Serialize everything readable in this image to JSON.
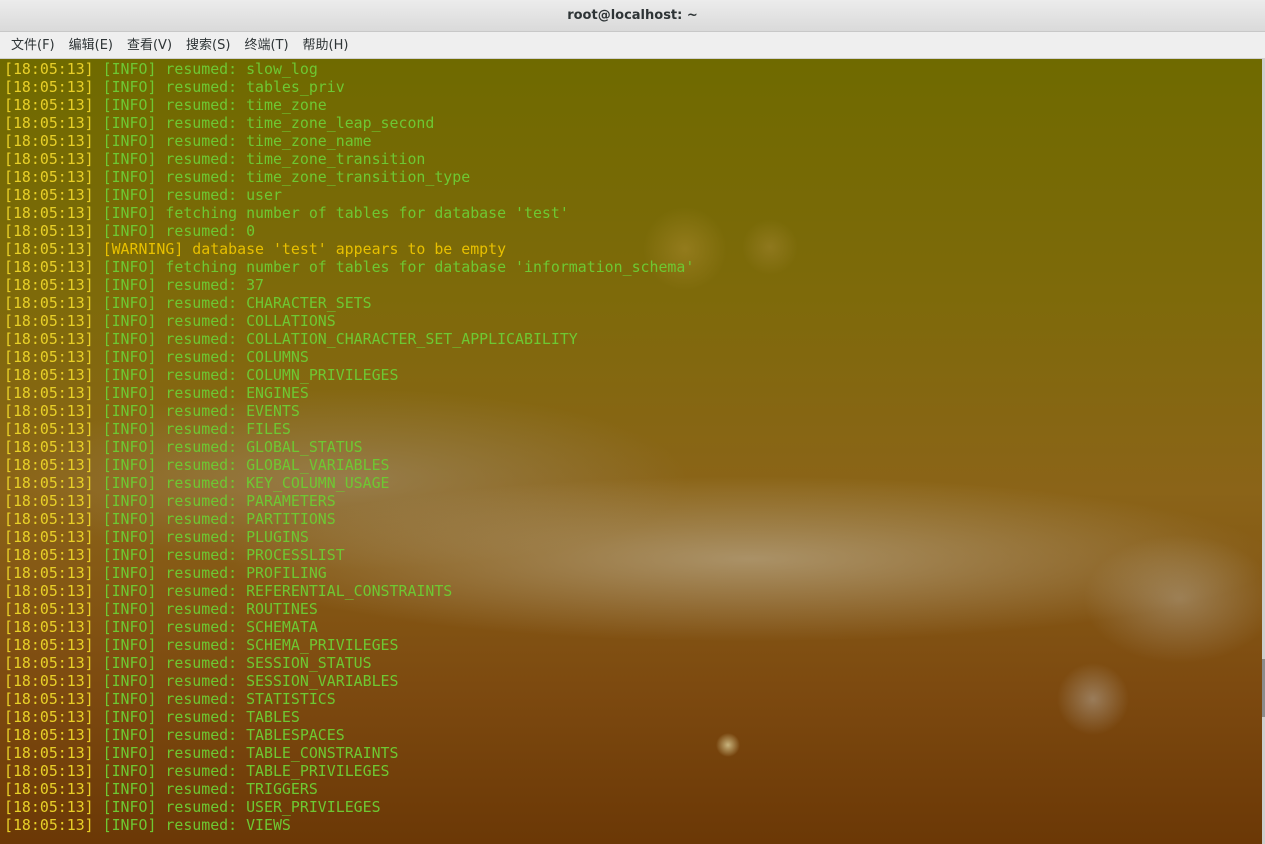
{
  "window": {
    "title": "root@localhost: ~"
  },
  "menu": [
    {
      "name": "menu-file",
      "label": "文件(F)"
    },
    {
      "name": "menu-edit",
      "label": "编辑(E)"
    },
    {
      "name": "menu-view",
      "label": "查看(V)"
    },
    {
      "name": "menu-search",
      "label": "搜索(S)"
    },
    {
      "name": "menu-terminal",
      "label": "终端(T)"
    },
    {
      "name": "menu-help",
      "label": "帮助(H)"
    }
  ],
  "colors": {
    "timestamp": "#e8d028",
    "info": "#6ec832",
    "warning": "#e8c000"
  },
  "log_lines": [
    {
      "time": "[18:05:13]",
      "level": "[INFO]",
      "message": "resumed: slow_log"
    },
    {
      "time": "[18:05:13]",
      "level": "[INFO]",
      "message": "resumed: tables_priv"
    },
    {
      "time": "[18:05:13]",
      "level": "[INFO]",
      "message": "resumed: time_zone"
    },
    {
      "time": "[18:05:13]",
      "level": "[INFO]",
      "message": "resumed: time_zone_leap_second"
    },
    {
      "time": "[18:05:13]",
      "level": "[INFO]",
      "message": "resumed: time_zone_name"
    },
    {
      "time": "[18:05:13]",
      "level": "[INFO]",
      "message": "resumed: time_zone_transition"
    },
    {
      "time": "[18:05:13]",
      "level": "[INFO]",
      "message": "resumed: time_zone_transition_type"
    },
    {
      "time": "[18:05:13]",
      "level": "[INFO]",
      "message": "resumed: user"
    },
    {
      "time": "[18:05:13]",
      "level": "[INFO]",
      "message": "fetching number of tables for database 'test'"
    },
    {
      "time": "[18:05:13]",
      "level": "[INFO]",
      "message": "resumed: 0"
    },
    {
      "time": "[18:05:13]",
      "level": "[WARNING]",
      "message": "database 'test' appears to be empty"
    },
    {
      "time": "[18:05:13]",
      "level": "[INFO]",
      "message": "fetching number of tables for database 'information_schema'"
    },
    {
      "time": "[18:05:13]",
      "level": "[INFO]",
      "message": "resumed: 37"
    },
    {
      "time": "[18:05:13]",
      "level": "[INFO]",
      "message": "resumed: CHARACTER_SETS"
    },
    {
      "time": "[18:05:13]",
      "level": "[INFO]",
      "message": "resumed: COLLATIONS"
    },
    {
      "time": "[18:05:13]",
      "level": "[INFO]",
      "message": "resumed: COLLATION_CHARACTER_SET_APPLICABILITY"
    },
    {
      "time": "[18:05:13]",
      "level": "[INFO]",
      "message": "resumed: COLUMNS"
    },
    {
      "time": "[18:05:13]",
      "level": "[INFO]",
      "message": "resumed: COLUMN_PRIVILEGES"
    },
    {
      "time": "[18:05:13]",
      "level": "[INFO]",
      "message": "resumed: ENGINES"
    },
    {
      "time": "[18:05:13]",
      "level": "[INFO]",
      "message": "resumed: EVENTS"
    },
    {
      "time": "[18:05:13]",
      "level": "[INFO]",
      "message": "resumed: FILES"
    },
    {
      "time": "[18:05:13]",
      "level": "[INFO]",
      "message": "resumed: GLOBAL_STATUS"
    },
    {
      "time": "[18:05:13]",
      "level": "[INFO]",
      "message": "resumed: GLOBAL_VARIABLES"
    },
    {
      "time": "[18:05:13]",
      "level": "[INFO]",
      "message": "resumed: KEY_COLUMN_USAGE"
    },
    {
      "time": "[18:05:13]",
      "level": "[INFO]",
      "message": "resumed: PARAMETERS"
    },
    {
      "time": "[18:05:13]",
      "level": "[INFO]",
      "message": "resumed: PARTITIONS"
    },
    {
      "time": "[18:05:13]",
      "level": "[INFO]",
      "message": "resumed: PLUGINS"
    },
    {
      "time": "[18:05:13]",
      "level": "[INFO]",
      "message": "resumed: PROCESSLIST"
    },
    {
      "time": "[18:05:13]",
      "level": "[INFO]",
      "message": "resumed: PROFILING"
    },
    {
      "time": "[18:05:13]",
      "level": "[INFO]",
      "message": "resumed: REFERENTIAL_CONSTRAINTS"
    },
    {
      "time": "[18:05:13]",
      "level": "[INFO]",
      "message": "resumed: ROUTINES"
    },
    {
      "time": "[18:05:13]",
      "level": "[INFO]",
      "message": "resumed: SCHEMATA"
    },
    {
      "time": "[18:05:13]",
      "level": "[INFO]",
      "message": "resumed: SCHEMA_PRIVILEGES"
    },
    {
      "time": "[18:05:13]",
      "level": "[INFO]",
      "message": "resumed: SESSION_STATUS"
    },
    {
      "time": "[18:05:13]",
      "level": "[INFO]",
      "message": "resumed: SESSION_VARIABLES"
    },
    {
      "time": "[18:05:13]",
      "level": "[INFO]",
      "message": "resumed: STATISTICS"
    },
    {
      "time": "[18:05:13]",
      "level": "[INFO]",
      "message": "resumed: TABLES"
    },
    {
      "time": "[18:05:13]",
      "level": "[INFO]",
      "message": "resumed: TABLESPACES"
    },
    {
      "time": "[18:05:13]",
      "level": "[INFO]",
      "message": "resumed: TABLE_CONSTRAINTS"
    },
    {
      "time": "[18:05:13]",
      "level": "[INFO]",
      "message": "resumed: TABLE_PRIVILEGES"
    },
    {
      "time": "[18:05:13]",
      "level": "[INFO]",
      "message": "resumed: TRIGGERS"
    },
    {
      "time": "[18:05:13]",
      "level": "[INFO]",
      "message": "resumed: USER_PRIVILEGES"
    },
    {
      "time": "[18:05:13]",
      "level": "[INFO]",
      "message": "resumed: VIEWS"
    }
  ]
}
